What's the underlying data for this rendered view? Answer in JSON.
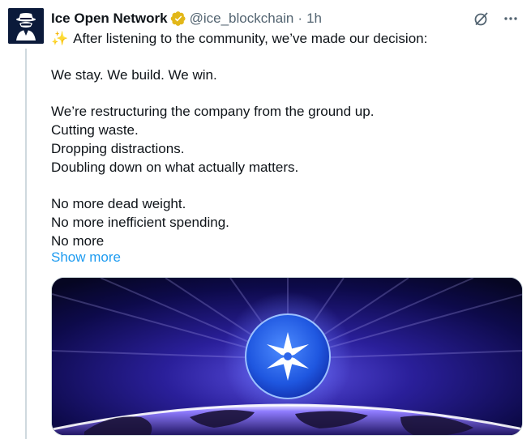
{
  "tweet": {
    "author_name": "Ice Open Network",
    "handle": "@ice_blockchain",
    "separator": "·",
    "time": "1h",
    "lines": {
      "l1": "After listening to the community, we’ve made our decision:",
      "l2": "We stay. We build. We win.",
      "l3": "We’re restructuring the company from the ground up.",
      "l4": "Cutting waste.",
      "l5": "Dropping distractions.",
      "l6": "Doubling down on what actually matters.",
      "l7": "No more dead weight.",
      "l8": "No more inefficient spending.",
      "l9": "No more"
    },
    "show_more": "Show more",
    "emoji": "✨"
  },
  "colors": {
    "accent": "#1d9bf0",
    "verified": "#e2b719",
    "text": "#0f1419",
    "muted": "#536471"
  },
  "icons": {
    "verified": "verified-badge-icon",
    "grok": "grok-icon",
    "more": "more-icon",
    "logo": "star-logo-icon"
  }
}
